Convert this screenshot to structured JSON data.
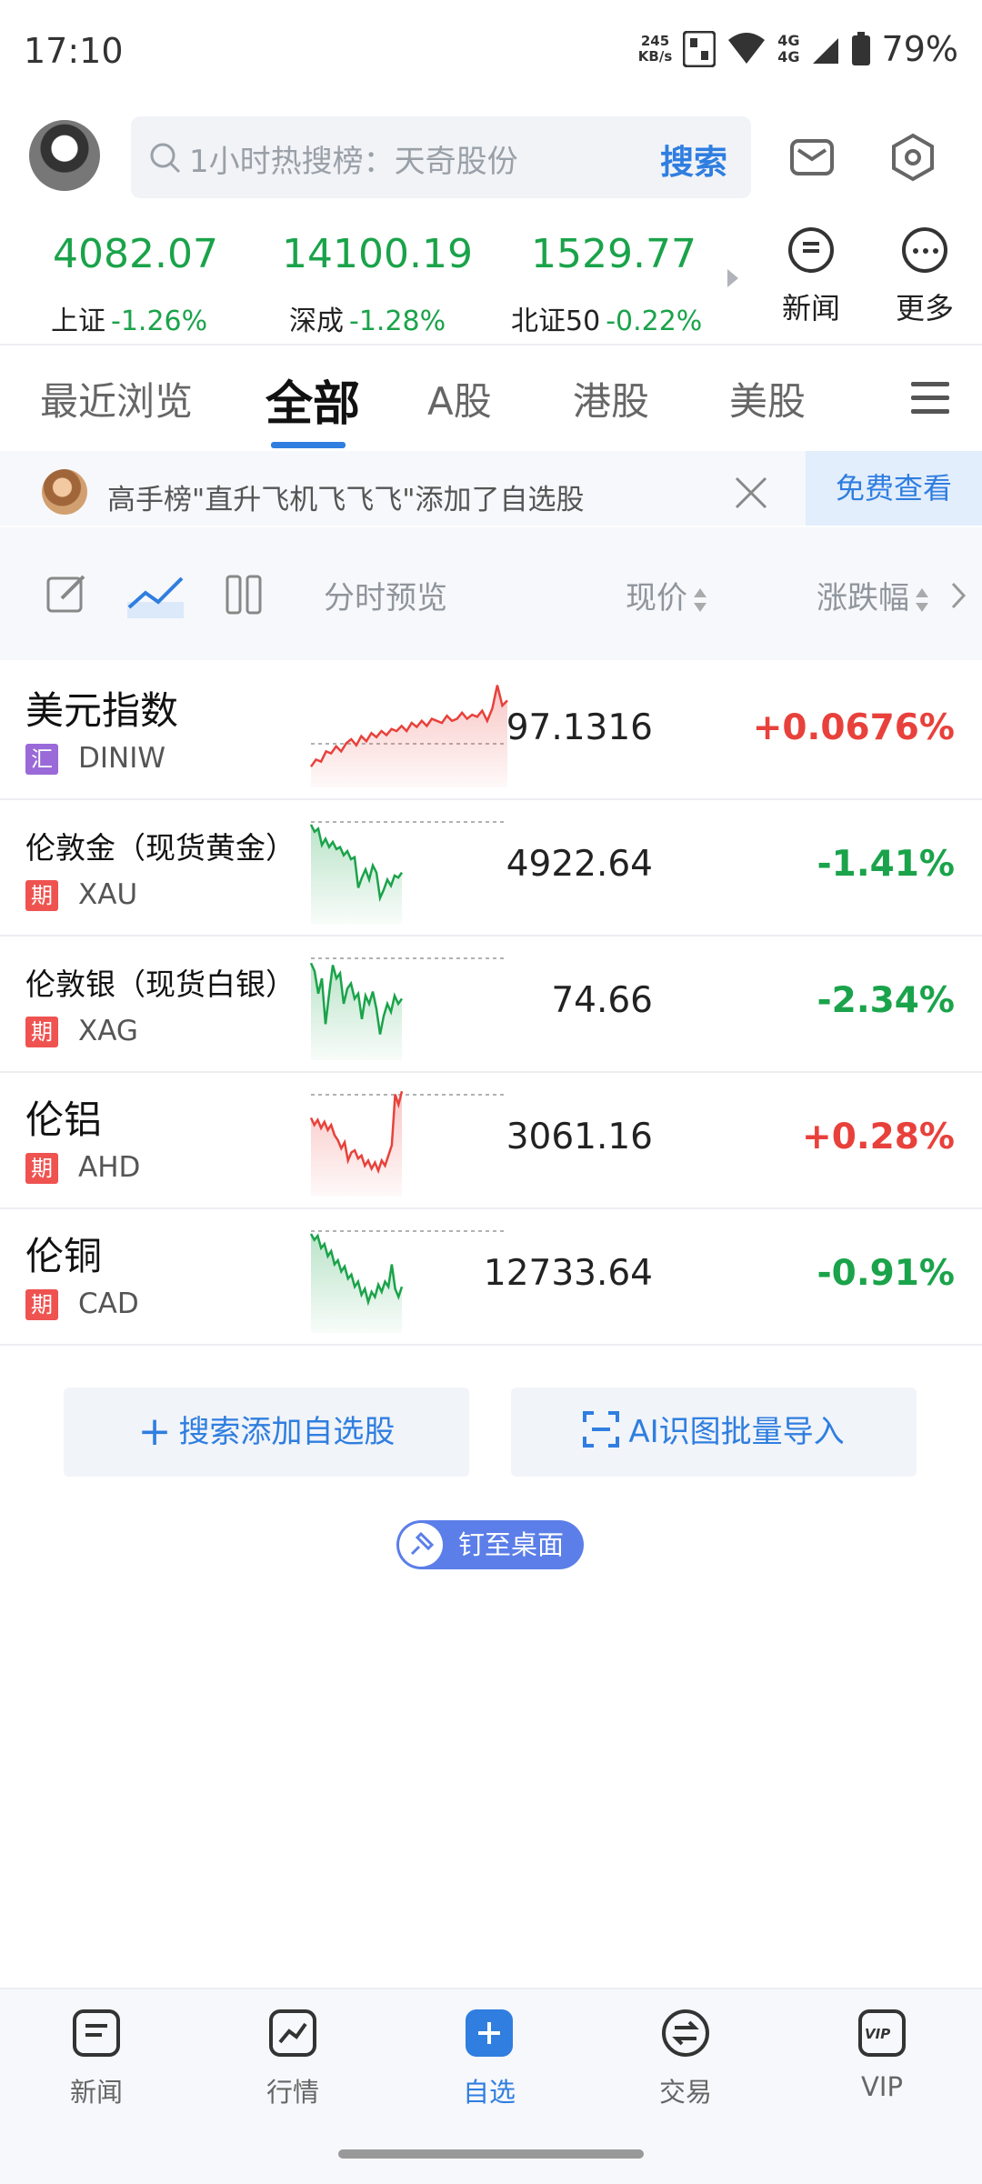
{
  "status_bar": {
    "time": "17:10",
    "speed_value": "245",
    "speed_unit": "KB/s",
    "network1": "4G",
    "network2": "4G",
    "battery": "79%"
  },
  "header": {
    "search_placeholder": "1小时热搜榜：天奇股份",
    "search_button": "搜索"
  },
  "indices": [
    {
      "value": "4082.07",
      "name": "上证",
      "change": "-1.26%"
    },
    {
      "value": "14100.19",
      "name": "深成",
      "change": "-1.28%"
    },
    {
      "value": "1529.77",
      "name": "北证50",
      "change": "-0.22%"
    }
  ],
  "quick_buttons": {
    "news": "新闻",
    "more": "更多"
  },
  "tabs": [
    "最近浏览",
    "全部",
    "A股",
    "港股",
    "美股"
  ],
  "notification": {
    "text": "高手榜\"直升飞机飞飞飞\"添加了自选股",
    "action": "免费查看"
  },
  "toolbar": {
    "preview": "分时预览",
    "price": "现价",
    "change": "涨跌幅"
  },
  "watchlist": [
    {
      "name": "美元指数",
      "tag": "汇",
      "code": "DINIW",
      "price": "97.1316",
      "change": "+0.0676%",
      "direction": "up",
      "spark": [
        0.15,
        0.22,
        0.2,
        0.3,
        0.28,
        0.35,
        0.3,
        0.38,
        0.42,
        0.36,
        0.45,
        0.4,
        0.48,
        0.44,
        0.5,
        0.46,
        0.52,
        0.5,
        0.55,
        0.5,
        0.58,
        0.54,
        0.6,
        0.55,
        0.62,
        0.6,
        0.58,
        0.65,
        0.6,
        0.62,
        0.68,
        0.62,
        0.66,
        0.64,
        0.7,
        0.6,
        0.72,
        0.95,
        0.75,
        0.8
      ]
    },
    {
      "name": "伦敦金（现货黄金）",
      "tag": "期",
      "code": "XAU",
      "price": "4922.64",
      "change": "-1.41%",
      "direction": "down",
      "spark": [
        0.92,
        0.85,
        0.88,
        0.72,
        0.78,
        0.7,
        0.75,
        0.68,
        0.7,
        0.62,
        0.66,
        0.58,
        0.6,
        0.3,
        0.4,
        0.48,
        0.38,
        0.52,
        0.45,
        0.2,
        0.28,
        0.38,
        0.32,
        0.42,
        0.4,
        0.45
      ]
    },
    {
      "name": "伦敦银（现货白银）",
      "tag": "期",
      "code": "XAG",
      "price": "74.66",
      "change": "-2.34%",
      "direction": "down",
      "spark": [
        0.9,
        0.82,
        0.6,
        0.75,
        0.3,
        0.6,
        0.88,
        0.75,
        0.8,
        0.5,
        0.65,
        0.7,
        0.55,
        0.6,
        0.35,
        0.58,
        0.5,
        0.62,
        0.45,
        0.2,
        0.38,
        0.5,
        0.42,
        0.58,
        0.5,
        0.55
      ]
    },
    {
      "name": "伦铝",
      "tag": "期",
      "code": "AHD",
      "price": "3061.16",
      "change": "+0.28%",
      "direction": "up",
      "spark": [
        0.72,
        0.65,
        0.7,
        0.62,
        0.68,
        0.6,
        0.65,
        0.55,
        0.5,
        0.42,
        0.48,
        0.3,
        0.38,
        0.4,
        0.32,
        0.35,
        0.25,
        0.3,
        0.22,
        0.28,
        0.2,
        0.3,
        0.25,
        0.35,
        0.45,
        0.95,
        0.85,
        0.98
      ]
    },
    {
      "name": "伦铜",
      "tag": "期",
      "code": "CAD",
      "price": "12733.64",
      "change": "-0.91%",
      "direction": "down",
      "spark": [
        0.92,
        0.86,
        0.9,
        0.78,
        0.82,
        0.7,
        0.75,
        0.62,
        0.66,
        0.55,
        0.6,
        0.48,
        0.52,
        0.4,
        0.45,
        0.32,
        0.38,
        0.25,
        0.35,
        0.3,
        0.42,
        0.35,
        0.45,
        0.4,
        0.62,
        0.38,
        0.3,
        0.4
      ]
    }
  ],
  "actions": {
    "add": "搜索添加自选股",
    "import": "AI识图批量导入",
    "pin": "钉至桌面"
  },
  "bottom_nav": [
    {
      "label": "新闻"
    },
    {
      "label": "行情"
    },
    {
      "label": "自选"
    },
    {
      "label": "交易"
    },
    {
      "label": "VIP"
    }
  ],
  "colors": {
    "up": "#e8413b",
    "down": "#1aa34a",
    "accent": "#2f7ee0"
  }
}
